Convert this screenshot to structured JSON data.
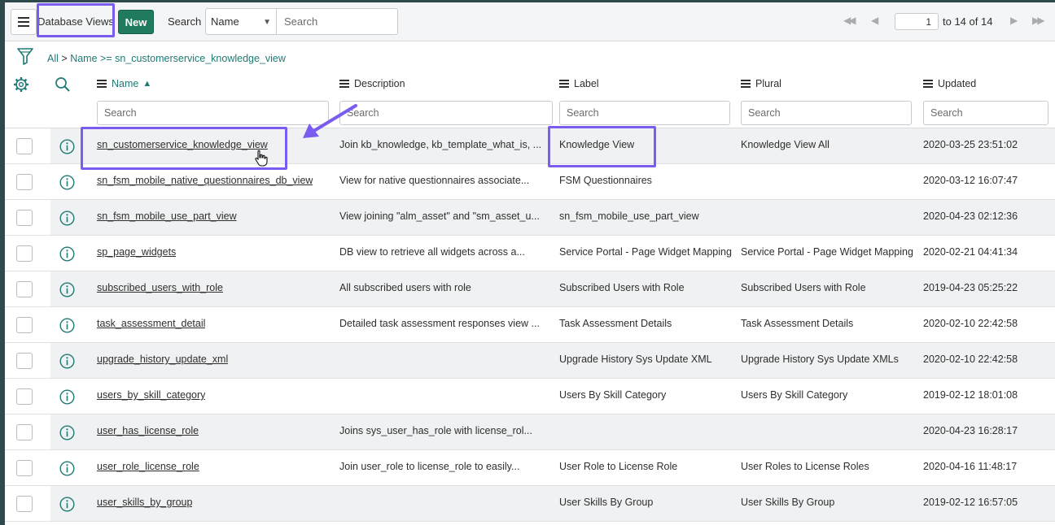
{
  "header": {
    "list_title": "Database Views",
    "new_label": "New",
    "search_label": "Search",
    "field_selected": "Name",
    "search_placeholder": "Search",
    "page_current": "1",
    "page_range_text": "to 14 of 14"
  },
  "breadcrumb": {
    "all": "All",
    "separator": ">",
    "condition": "Name >= sn_customerservice_knowledge_view"
  },
  "columns": [
    {
      "label": "Name",
      "sort": "▲",
      "search_placeholder": "Search"
    },
    {
      "label": "Description",
      "search_placeholder": "Search"
    },
    {
      "label": "Label",
      "search_placeholder": "Search"
    },
    {
      "label": "Plural",
      "search_placeholder": "Search"
    },
    {
      "label": "Updated",
      "search_placeholder": "Search"
    }
  ],
  "rows": [
    {
      "name": "sn_customerservice_knowledge_view",
      "description": "Join kb_knowledge, kb_template_what_is, ...",
      "label": "Knowledge View",
      "plural": "Knowledge View All",
      "updated": "2020-03-25 23:51:02"
    },
    {
      "name": "sn_fsm_mobile_native_questionnaires_db_view",
      "description": "View for native questionnaires associate...",
      "label": "FSM Questionnaires",
      "plural": "",
      "updated": "2020-03-12 16:07:47"
    },
    {
      "name": "sn_fsm_mobile_use_part_view",
      "description": "View joining \"alm_asset\" and \"sm_asset_u...",
      "label": "sn_fsm_mobile_use_part_view",
      "plural": "",
      "updated": "2020-04-23 02:12:36"
    },
    {
      "name": "sp_page_widgets",
      "description": "DB view to retrieve all widgets across a...",
      "label": "Service Portal - Page Widget Mapping",
      "plural": "Service Portal - Page Widget Mapping",
      "updated": "2020-02-21 04:41:34"
    },
    {
      "name": "subscribed_users_with_role",
      "description": "All subscribed users with role",
      "label": "Subscribed Users with Role",
      "plural": "Subscribed Users with Role",
      "updated": "2019-04-23 05:25:22"
    },
    {
      "name": "task_assessment_detail",
      "description": "Detailed task assessment responses view ...",
      "label": "Task Assessment Details",
      "plural": "Task Assessment Details",
      "updated": "2020-02-10 22:42:58"
    },
    {
      "name": "upgrade_history_update_xml",
      "description": "",
      "label": "Upgrade History Sys Update XML",
      "plural": "Upgrade History Sys Update XMLs",
      "updated": "2020-02-10 22:42:58"
    },
    {
      "name": "users_by_skill_category",
      "description": "",
      "label": "Users By Skill Category",
      "plural": "Users By Skill Category",
      "updated": "2019-02-12 18:01:08"
    },
    {
      "name": "user_has_license_role",
      "description": "Joins sys_user_has_role with license_rol...",
      "label": "",
      "plural": "",
      "updated": "2020-04-23 16:28:17"
    },
    {
      "name": "user_role_license_role",
      "description": "Join user_role to license_role to easily...",
      "label": "User Role to License Role",
      "plural": "User Roles to License Roles",
      "updated": "2020-04-16 11:48:17"
    },
    {
      "name": "user_skills_by_group",
      "description": "",
      "label": "User Skills By Group",
      "plural": "User Skills By Group",
      "updated": "2019-02-12 16:57:05"
    }
  ],
  "colors": {
    "accent_green": "#1f7a5e",
    "link_teal": "#1f7a74",
    "annotation_purple": "#7b5cf0",
    "nav_dark": "#2f4a4d"
  },
  "icons": [
    "hamburger-menu-icon",
    "filter-funnel-icon",
    "gear-icon",
    "search-icon",
    "info-icon",
    "first-page-icon",
    "previous-page-icon",
    "next-page-icon",
    "last-page-icon",
    "pointer-cursor-icon"
  ]
}
